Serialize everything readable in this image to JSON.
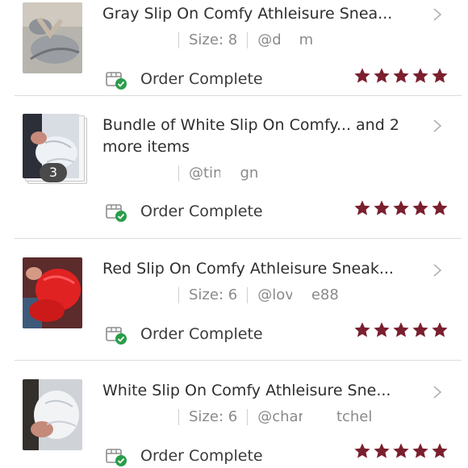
{
  "orders": [
    {
      "title": "Gray Slip On Comfy Athleisure Snea...",
      "size": "Size: 8",
      "seller_visible": "@d",
      "seller_tail": "m",
      "status": "Order Complete",
      "rating": 5
    },
    {
      "title": "Bundle of White Slip On Comfy... and 2 more items",
      "quantity": "3",
      "seller_visible": "@tin",
      "seller_tail": "gn",
      "status": "Order Complete",
      "rating": 5
    },
    {
      "title": "Red Slip On Comfy Athleisure Sneak...",
      "size": "Size: 6",
      "seller_visible": "@lov",
      "seller_tail": "e88",
      "status": "Order Complete",
      "rating": 5
    },
    {
      "title": "White Slip On Comfy Athleisure Sne...",
      "size": "Size: 6",
      "seller_visible": "@char",
      "seller_tail": "tchel",
      "status": "Order Complete",
      "rating": 5
    }
  ],
  "colors": {
    "star": "#7a1f2e",
    "check": "#2a9d4b",
    "divider": "#dcdcdc",
    "muted_text": "#8a8a8a"
  },
  "icons": {
    "status": "package-check-icon",
    "chevron": "chevron-right-icon",
    "star": "star-icon"
  }
}
